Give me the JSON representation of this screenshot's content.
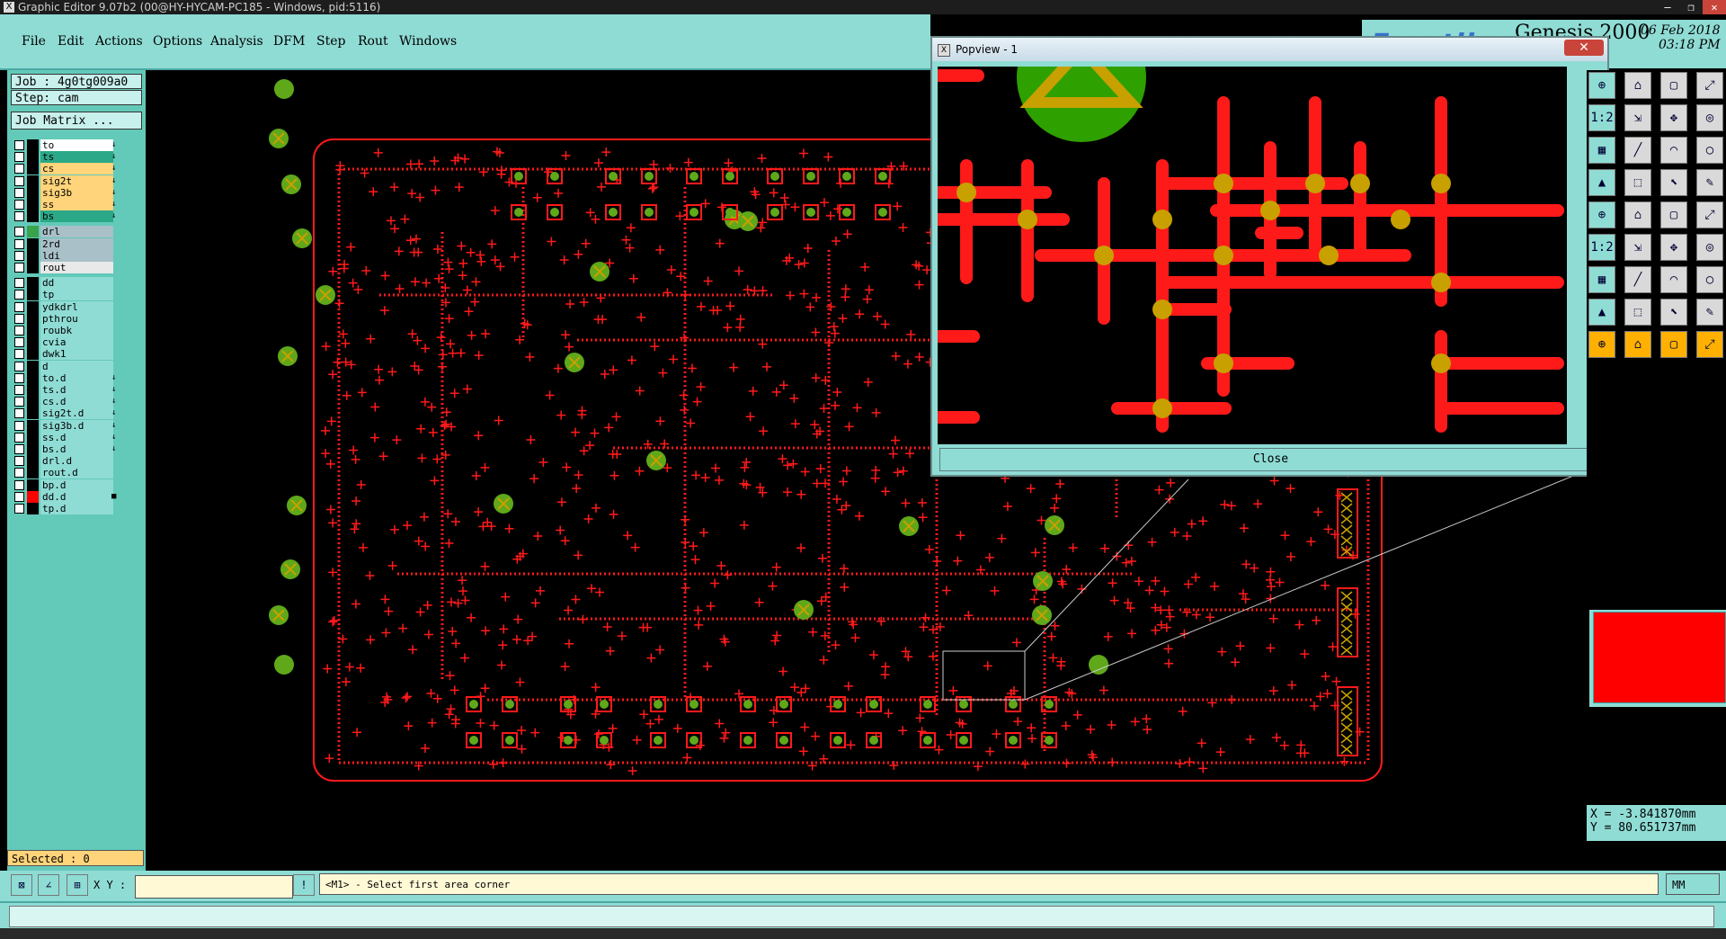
{
  "window": {
    "title": "Graphic Editor 9.07b2 (00@HY-HYCAM-PC185 - Windows, pid:5116)",
    "controls": [
      "—",
      "❐",
      "✕"
    ]
  },
  "menu": [
    "File",
    "Edit",
    "Actions",
    "Options",
    "Analysis",
    "DFM",
    "Step",
    "Rout",
    "Windows"
  ],
  "brand": {
    "logo": "Frontline",
    "product": "Genesis 2000",
    "date": "06 Feb 2018",
    "time": "03:18 PM"
  },
  "job": {
    "job_label": "Job : 4g0tg009a0",
    "step_label": "Step: cam",
    "matrix_button": "Job Matrix ..."
  },
  "layers": [
    {
      "name": "to",
      "bg": "#ffffff",
      "swatch": "#000000",
      "flag": "↓"
    },
    {
      "name": "ts",
      "bg": "#2aa887",
      "swatch": "#000000",
      "flag": "↓"
    },
    {
      "name": "cs",
      "bg": "#ffd47a",
      "swatch": "#000000",
      "flag": "↓"
    },
    {
      "name": "sig2t",
      "bg": "#ffd47a",
      "swatch": "#000000",
      "flag": "↓"
    },
    {
      "name": "sig3b",
      "bg": "#ffd47a",
      "swatch": "#000000",
      "flag": "↓"
    },
    {
      "name": "ss",
      "bg": "#ffd47a",
      "swatch": "#000000",
      "flag": "↓"
    },
    {
      "name": "bs",
      "bg": "#2aa887",
      "swatch": "#000000",
      "flag": "↓"
    },
    {
      "name": "drl",
      "bg": "#a9c0c8",
      "swatch": "#3aa24a",
      "flag": ""
    },
    {
      "name": "2rd",
      "bg": "#a9c0c8",
      "swatch": "#000000",
      "flag": ""
    },
    {
      "name": "ldi",
      "bg": "#a9c0c8",
      "swatch": "#000000",
      "flag": ""
    },
    {
      "name": "rout",
      "bg": "#e9e9e9",
      "swatch": "#000000",
      "flag": ""
    },
    {
      "name": "dd",
      "bg": "#8fdcd5",
      "swatch": "#000000",
      "flag": ""
    },
    {
      "name": "tp",
      "bg": "#8fdcd5",
      "swatch": "#000000",
      "flag": ""
    },
    {
      "name": "ydkdrl",
      "bg": "#8fdcd5",
      "swatch": "#000000",
      "flag": ""
    },
    {
      "name": "pthrou",
      "bg": "#8fdcd5",
      "swatch": "#000000",
      "flag": ""
    },
    {
      "name": "roubk",
      "bg": "#8fdcd5",
      "swatch": "#000000",
      "flag": ""
    },
    {
      "name": "cvia",
      "bg": "#8fdcd5",
      "swatch": "#000000",
      "flag": ""
    },
    {
      "name": "dwk1",
      "bg": "#8fdcd5",
      "swatch": "#000000",
      "flag": ""
    },
    {
      "name": "d",
      "bg": "#8fdcd5",
      "swatch": "#000000",
      "flag": ""
    },
    {
      "name": "to.d",
      "bg": "#8fdcd5",
      "swatch": "#000000",
      "flag": "↓"
    },
    {
      "name": "ts.d",
      "bg": "#8fdcd5",
      "swatch": "#000000",
      "flag": "↓"
    },
    {
      "name": "cs.d",
      "bg": "#8fdcd5",
      "swatch": "#000000",
      "flag": "↓"
    },
    {
      "name": "sig2t.d",
      "bg": "#8fdcd5",
      "swatch": "#000000",
      "flag": "↓"
    },
    {
      "name": "sig3b.d",
      "bg": "#8fdcd5",
      "swatch": "#000000",
      "flag": "↓"
    },
    {
      "name": "ss.d",
      "bg": "#8fdcd5",
      "swatch": "#000000",
      "flag": "↓"
    },
    {
      "name": "bs.d",
      "bg": "#8fdcd5",
      "swatch": "#000000",
      "flag": "↓"
    },
    {
      "name": "drl.d",
      "bg": "#8fdcd5",
      "swatch": "#000000",
      "flag": ""
    },
    {
      "name": "rout.d",
      "bg": "#8fdcd5",
      "swatch": "#000000",
      "flag": ""
    },
    {
      "name": "bp.d",
      "bg": "#8fdcd5",
      "swatch": "#000000",
      "flag": ""
    },
    {
      "name": "dd.d",
      "bg": "#8fdcd5",
      "swatch": "#ff0000",
      "flag": "■"
    },
    {
      "name": "tp.d",
      "bg": "#8fdcd5",
      "swatch": "#000000",
      "flag": ""
    }
  ],
  "status": {
    "selected": "Selected : 0",
    "xy_label": "X Y :",
    "xy_value": "",
    "prompt": "<M1> - Select first area corner",
    "units": "MM",
    "coord_x": "X = -3.841870mm",
    "coord_y": "Y = 80.651737mm"
  },
  "popview": {
    "title": "Popview - 1",
    "close_label": "Close"
  },
  "colors": {
    "panel_cyan": "#8fdcd5",
    "panel_teal": "#63c9b9",
    "board_red": "#ff1a1a",
    "pad_green": "#5fa81a",
    "pad_gold": "#c8a000"
  },
  "tool_icons": [
    "zoom-icon",
    "home-icon",
    "frame-icon",
    "fit-icon",
    "scale-1-2-icon",
    "measure-icon",
    "pan-icon",
    "snap-icon",
    "grid-icon",
    "line-icon",
    "arc-icon",
    "circle-icon",
    "poly-icon",
    "select-icon",
    "pointer-icon",
    "edit-icon"
  ]
}
